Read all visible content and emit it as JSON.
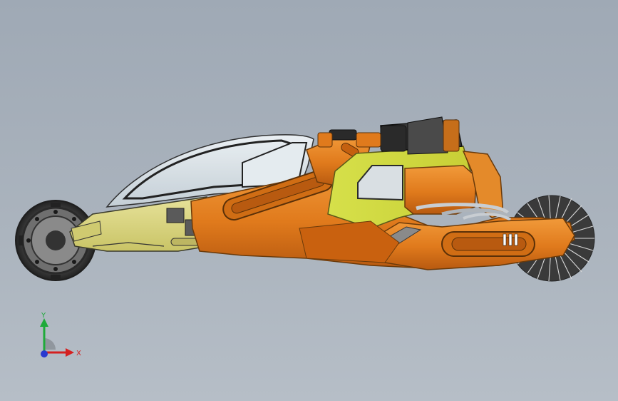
{
  "viewport": {
    "background_top": "#9fa9b5",
    "background_bottom": "#b6bec7"
  },
  "model": {
    "primary_color": "#e07a1c",
    "secondary_color": "#d8d47a",
    "tire_color": "#2a2a2a",
    "canopy_color": "#d9e3ea"
  },
  "triad": {
    "y_label": "Y",
    "x_label": "X",
    "y_color": "#1faa3a",
    "x_color": "#d42020",
    "z_color": "#2a3ad0"
  }
}
